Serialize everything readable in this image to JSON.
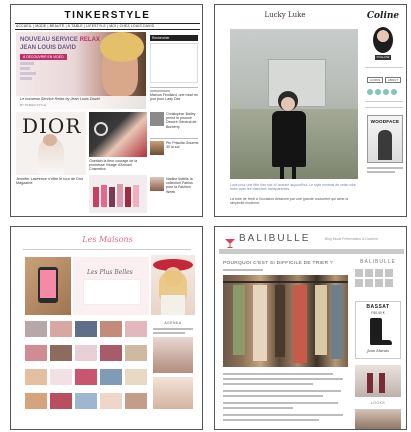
{
  "tile1": {
    "logo": "TINKERSTYLE",
    "nav": "ACCUEIL | MODE | BEAUTÉ | À TABLE | LIFESTYLE | MOI | CHEZ LOUIS DAVID",
    "hero_line1": "NOUVEAU SERVICE",
    "hero_highlight": "RELAX",
    "hero_line2": "JEAN LOUIS DAVID",
    "hero_tag": "À DÉCOUVRIR EN VIDÉO",
    "hero_caption": "Le nouveau Service Relax by Jean Louis David",
    "hero_byline": "BY TINKER STYLE",
    "sidebar_header": "Rechercher",
    "dior_text": "DIOR",
    "post1": "Marcus Feuillard, une mise en jour pour Lady Dior",
    "post2": "Christopher Bailey prend le pouvoir Décoré Général de Burberry",
    "post3": "Guerlain la fleur courage de la promesse Visage d'Armani Cosmetics",
    "post4": "Pin Priscilla Gourme 30 la sol",
    "post5": "Jennifer Lawrence s'offre le tour de Dior Magazine",
    "post6": "Nadine thêtille la collection Fabius pour la Fashion Week"
  },
  "tile2": {
    "title": "Lucky Luke",
    "profile_name": "Coline",
    "profile_badge": "FOLLOW",
    "btn1": "LOOKS",
    "btn2": "ABOUT",
    "mag_title": "WOODFACE",
    "caption": "Look pour une fête hier soir à l'avance aujourd'hui. Le style minimal de cette robe noire avec les manches transparentes.",
    "caption2": "La robe de Hedi à l'occasion dessinée par une grande couturière qui aime la simplicité moderne."
  },
  "tile3": {
    "logo": "Les Maisons",
    "slogan": "Les Plus Belles",
    "sidebar_label": "AGENDA"
  },
  "tile4": {
    "logo": "BALIBULLE",
    "tagline": "Blog Mode Présentation & Doctrine",
    "post_title": "POURQUOI C'EST SI DIFFICILE DE TRIER ?",
    "sidebar_logo": "BALIBULLE",
    "ad_brand": "BASSAT",
    "ad_price": "F60,00 €",
    "ad_sig": "Jean Marais",
    "sidebar_label": "LOOKS"
  }
}
